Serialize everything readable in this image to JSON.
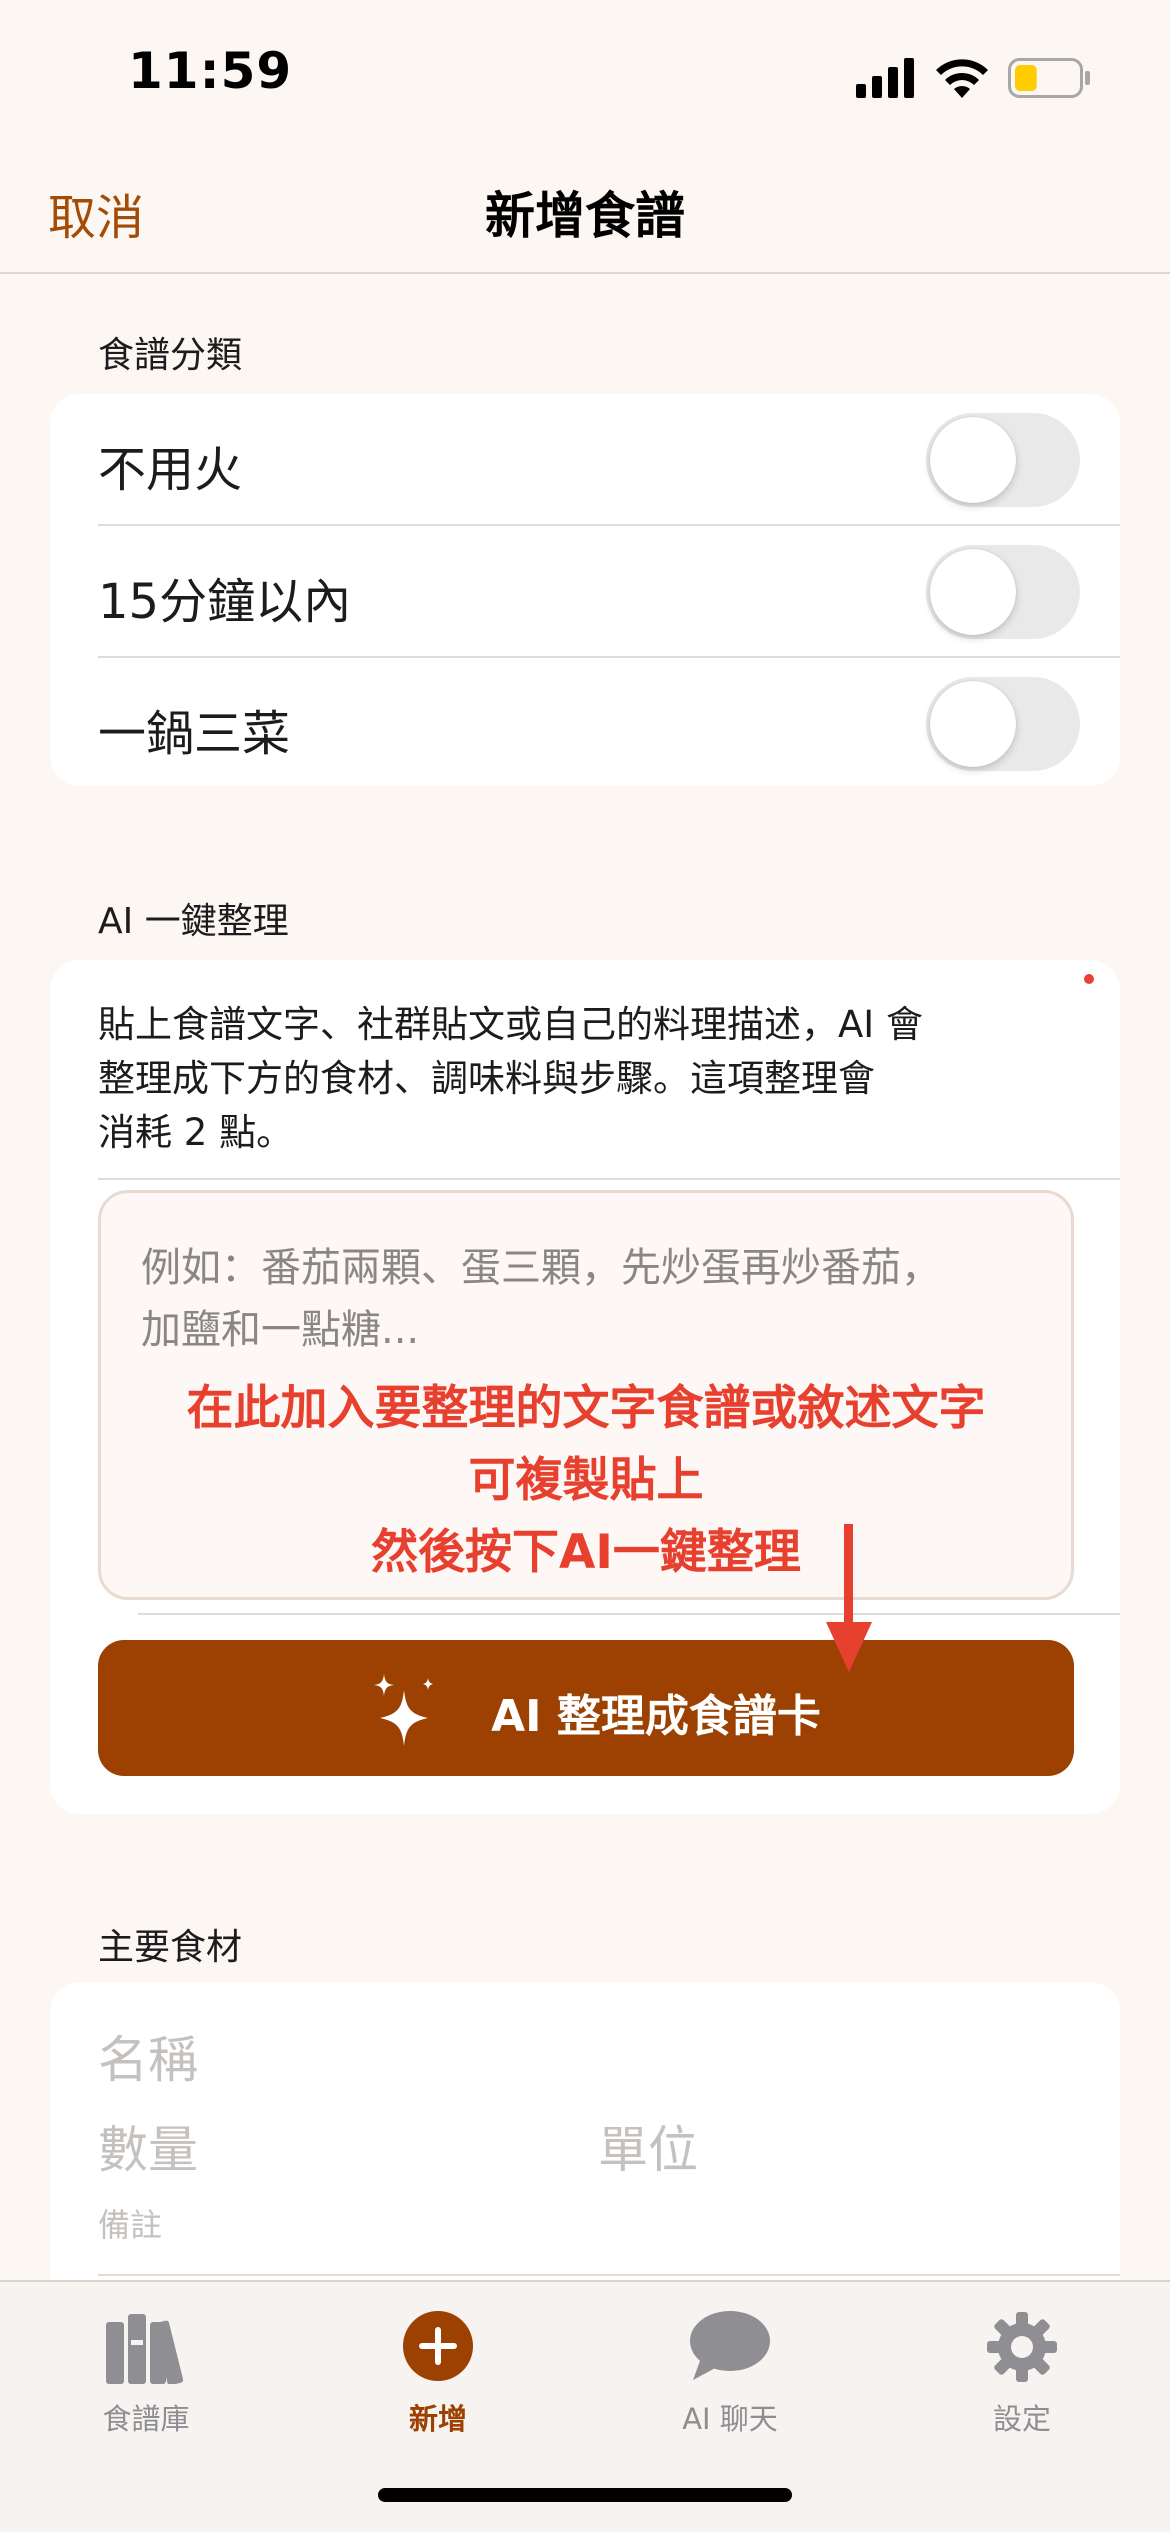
{
  "status_bar": {
    "time": "11:59",
    "battery_level": 0.35,
    "battery_color": "#ffcc00"
  },
  "nav": {
    "cancel_label": "取消",
    "title": "新增食譜"
  },
  "category_section": {
    "header": "食譜分類",
    "toggles": [
      {
        "label": "不用火",
        "on": false
      },
      {
        "label": "15分鐘以內",
        "on": false
      },
      {
        "label": "一鍋三菜",
        "on": false
      }
    ]
  },
  "ai_section": {
    "header": "AI 一鍵整理",
    "description_lines": [
      "貼上食譜文字、社群貼文或自己的料理描述，AI 會",
      "整理成下方的食材、調味料與步驟。這項整理會",
      "消耗 2 點。"
    ],
    "placeholder_lines": [
      "例如：番茄兩顆、蛋三顆，先炒蛋再炒番茄，",
      "加鹽和一點糖..."
    ],
    "annotation_lines": [
      "在此加入要整理的文字食譜或敘述文字",
      "可複製貼上",
      "然後按下AI一鍵整理"
    ],
    "button_label": "AI 整理成食譜卡",
    "button_icon": "sparkles-icon"
  },
  "ingredients_section": {
    "header": "主要食材",
    "name_placeholder": "名稱",
    "quantity_placeholder": "數量",
    "unit_placeholder": "單位",
    "note_placeholder": "備註"
  },
  "tab_bar": {
    "tabs": [
      {
        "label": "食譜庫",
        "icon": "books-icon",
        "active": false
      },
      {
        "label": "新增",
        "icon": "plus-circle-icon",
        "active": true
      },
      {
        "label": "AI 聊天",
        "icon": "chat-bubble-icon",
        "active": false
      },
      {
        "label": "設定",
        "icon": "gear-icon",
        "active": false
      }
    ]
  },
  "colors": {
    "accent": "#9c4102",
    "cancel_text": "#a44b06",
    "annotation_red": "#e8402f",
    "background": "#fcf7f3"
  }
}
